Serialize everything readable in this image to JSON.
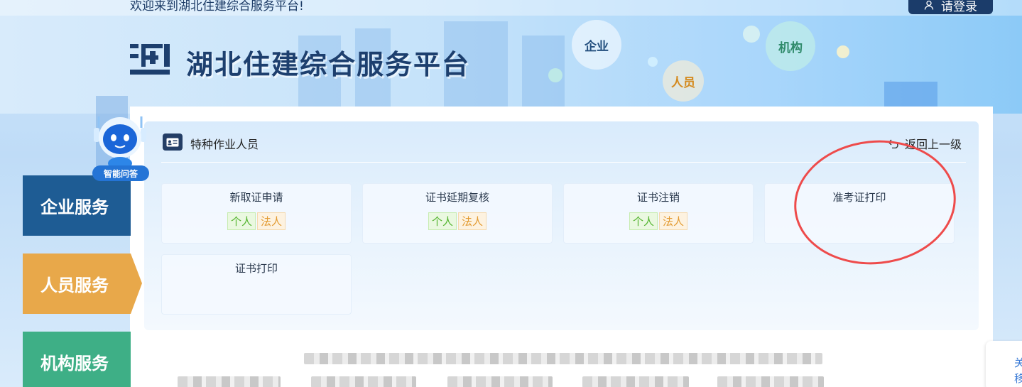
{
  "header": {
    "welcome_text": "欢迎来到湖北住建综合服务平台!",
    "login_label": "请登录",
    "site_title": "湖北住建综合服务平台",
    "bubbles": {
      "enterprise": "企业",
      "personnel": "人员",
      "organization": "机构"
    }
  },
  "assistant": {
    "label": "智能问答"
  },
  "nav": {
    "items": [
      {
        "label": "企业服务",
        "color": "#1e5c94"
      },
      {
        "label": "人员服务",
        "color": "#e8a84a",
        "active": true
      },
      {
        "label": "机构服务",
        "color": "#3eaf86"
      }
    ]
  },
  "section": {
    "title": "特种作业人员",
    "back_label": "返回上一级",
    "icon": "id-card-icon"
  },
  "tiles": [
    {
      "title": "新取证申请",
      "tags": [
        "个人",
        "法人"
      ]
    },
    {
      "title": "证书延期复核",
      "tags": [
        "个人",
        "法人"
      ]
    },
    {
      "title": "证书注销",
      "tags": [
        "个人",
        "法人"
      ]
    },
    {
      "title": "准考证打印",
      "tags": []
    },
    {
      "title": "证书打印",
      "tags": []
    }
  ],
  "side_widget": {
    "text_1": "关",
    "text_2": "移"
  },
  "colors": {
    "annotation": "#ee4b4b",
    "tag_green": "#54b430",
    "tag_orange": "#e39b32",
    "brand_dark": "#1b3c6a"
  }
}
